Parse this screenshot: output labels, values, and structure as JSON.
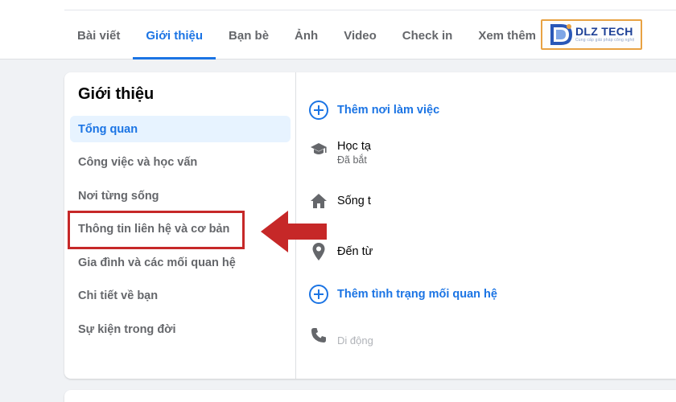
{
  "tabs": [
    {
      "label": "Bài viết",
      "active": false
    },
    {
      "label": "Giới thiệu",
      "active": true
    },
    {
      "label": "Bạn bè",
      "active": false
    },
    {
      "label": "Ảnh",
      "active": false
    },
    {
      "label": "Video",
      "active": false
    },
    {
      "label": "Check in",
      "active": false
    },
    {
      "label": "Xem thêm",
      "active": false
    }
  ],
  "logo": {
    "name": "DLZ TECH",
    "tagline": "Cung cấp giải pháp công nghệ"
  },
  "about": {
    "title": "Giới thiệu",
    "items": [
      {
        "label": "Tổng quan",
        "active": true
      },
      {
        "label": "Công việc và học vấn",
        "active": false
      },
      {
        "label": "Nơi từng sống",
        "active": false
      },
      {
        "label": "Thông tin liên hệ và cơ bản",
        "active": false
      },
      {
        "label": "Gia đình và các mối quan hệ",
        "active": false
      },
      {
        "label": "Chi tiết về bạn",
        "active": false
      },
      {
        "label": "Sự kiện trong đời",
        "active": false
      }
    ]
  },
  "overview": {
    "add_workplace": "Thêm nơi làm việc",
    "study": "Học tạ",
    "study_sub": "Đã bắt",
    "lives": "Sống t",
    "from": "Đến từ",
    "add_relationship": "Thêm tình trạng mối quan hệ",
    "mobile": "Di động"
  },
  "colors": {
    "accent": "#1b74e4",
    "annotation": "#c62828"
  }
}
